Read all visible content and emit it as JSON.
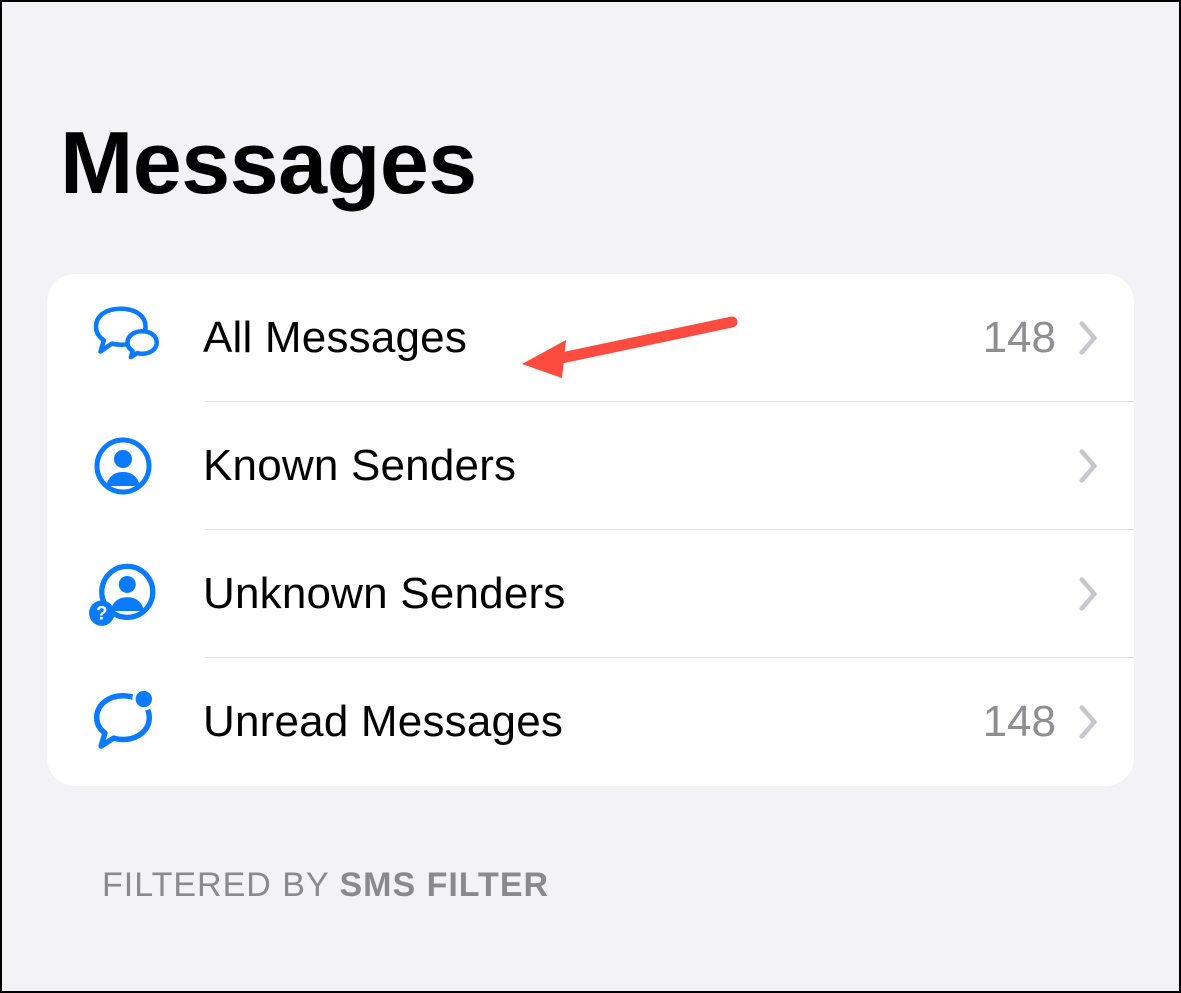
{
  "title": "Messages",
  "filters": [
    {
      "icon": "bubbles-icon",
      "label": "All Messages",
      "count": "148"
    },
    {
      "icon": "person-circle-icon",
      "label": "Known Senders",
      "count": ""
    },
    {
      "icon": "person-question-icon",
      "label": "Unknown Senders",
      "count": ""
    },
    {
      "icon": "bubble-unread-icon",
      "label": "Unread Messages",
      "count": "148"
    }
  ],
  "footer": {
    "prefix": "FILTERED BY ",
    "strong": "SMS FILTER"
  },
  "colors": {
    "accent": "#0a7aff",
    "arrow": "#fd4b3f"
  }
}
